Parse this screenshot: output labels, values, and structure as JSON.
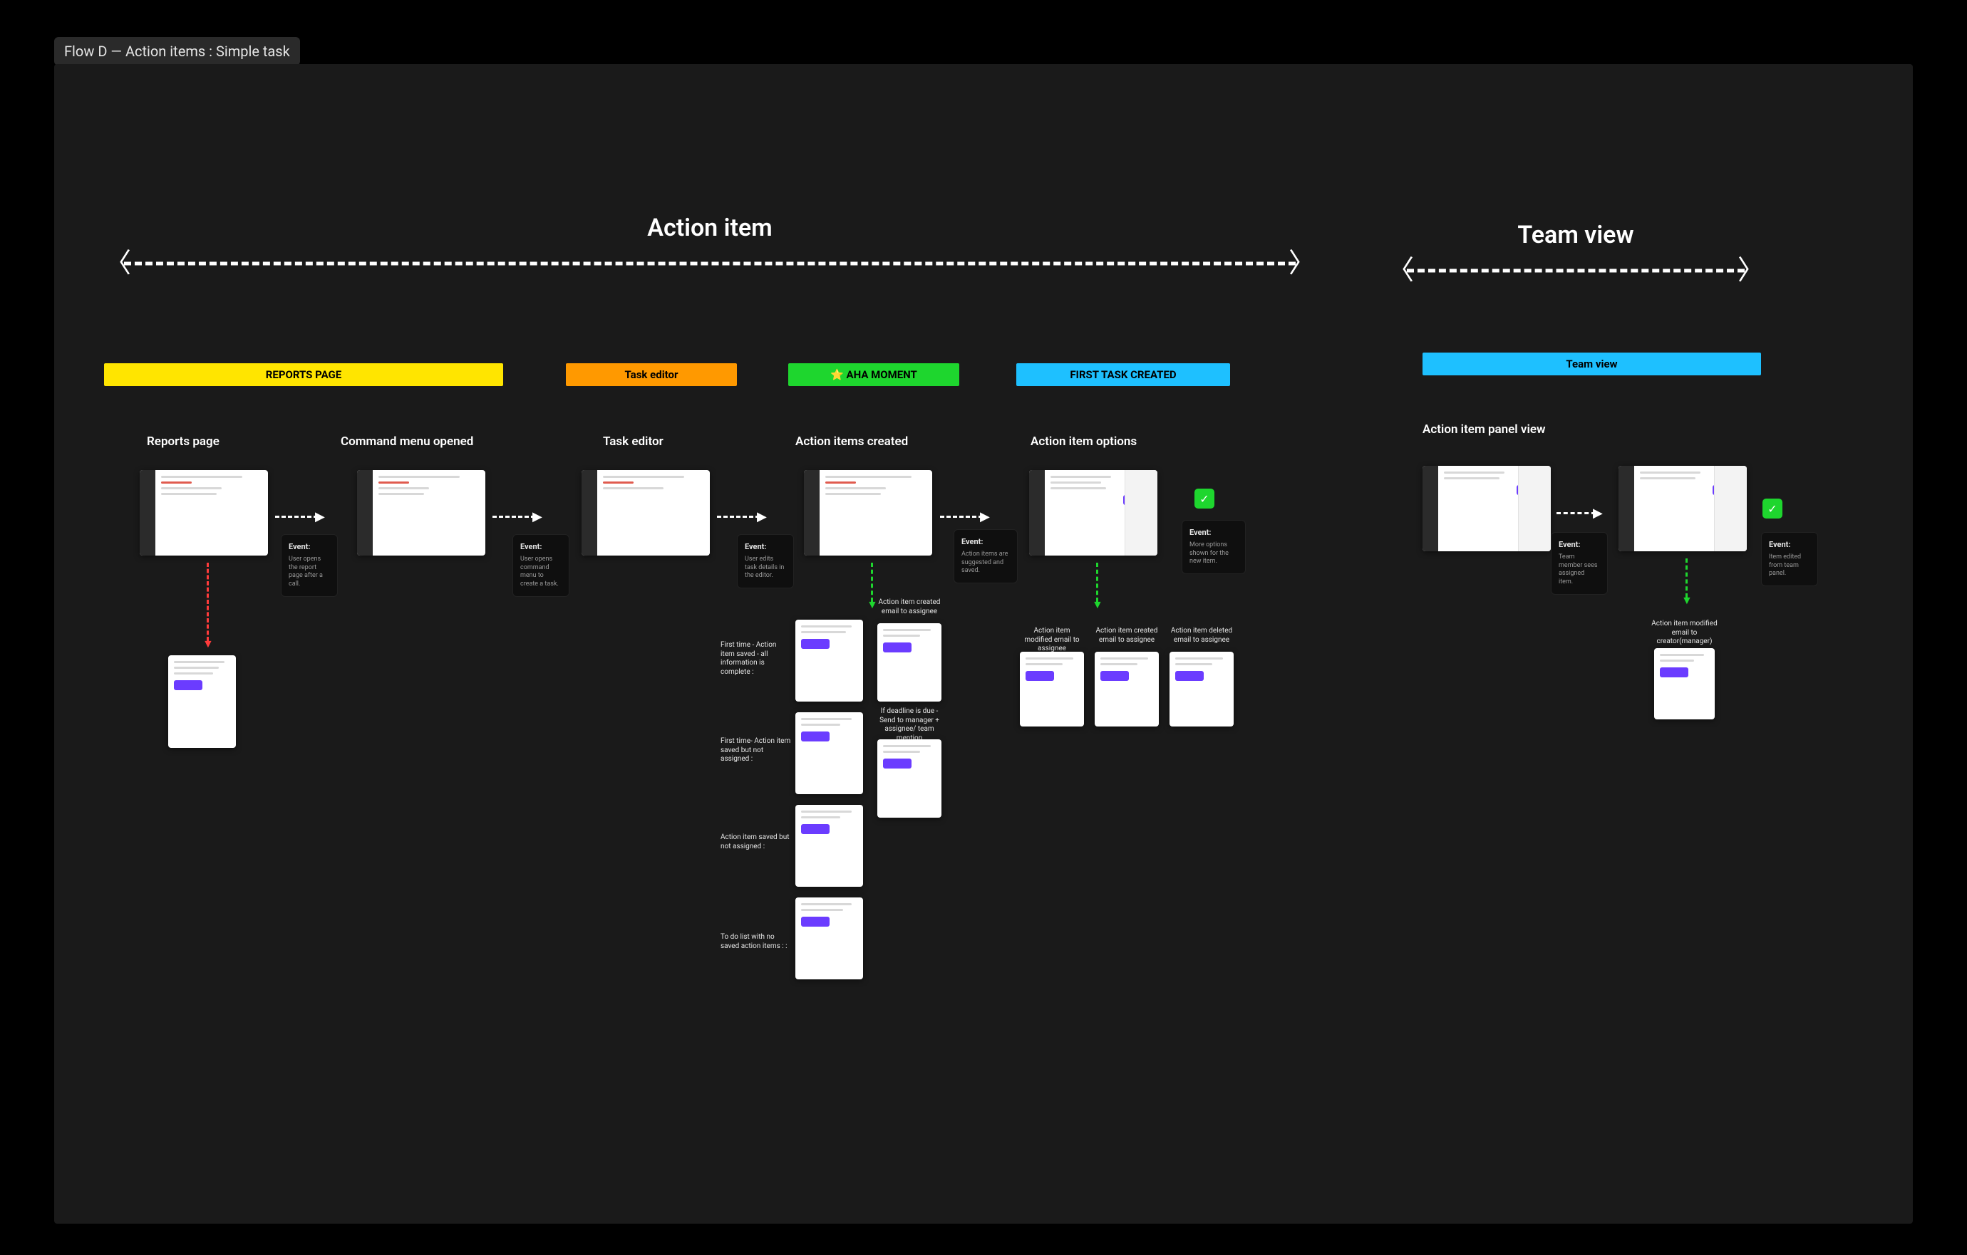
{
  "frame_title": "Flow D — Action items : Simple task",
  "sections": {
    "action_item": {
      "title": "Action item"
    },
    "team_view": {
      "title": "Team view"
    }
  },
  "badges": {
    "reports_page": "REPORTS PAGE",
    "task_editor": "Task editor",
    "aha_moment": "⭐ AHA MOMENT",
    "first_task_created": "FIRST TASK CREATED",
    "team_view": "Team view"
  },
  "columns": {
    "reports_page": "Reports page",
    "command_menu": "Command menu opened",
    "task_editor": "Task editor",
    "action_items_created": "Action items created",
    "action_item_options": "Action item options",
    "action_item_panel": "Action item panel view"
  },
  "notes": {
    "event_title": "Event:",
    "event1_body": "User opens the report page after a call.",
    "event2_body": "User opens command menu to create a task.",
    "event3_body": "User edits task details in the editor.",
    "event4_body": "Action items are suggested and saved.",
    "event5_body": "More options shown for the new item.",
    "team_body": "Team member sees assigned item.",
    "team2_body": "Item edited from team panel."
  },
  "tiny_labels": {
    "created_email": "Action item created email to assignee",
    "first_saved_complete": "First time - Action item saved - all information is complete :",
    "first_saved_not_assigned": "First time- Action item saved but not assigned :",
    "saved_not_assigned": "Action item saved but not assigned :",
    "todo_no_saved": "To do list with no saved action items : :",
    "deadline_due": "If deadline is due - Send to manager + assignee/ team mention",
    "modified_email": "Action item modified email to assignee",
    "created_email2": "Action item created email to assignee",
    "deleted_email": "Action item deleted email to assignee",
    "modified_creator": "Action item modified email to creator(manager)"
  },
  "check": "✓"
}
